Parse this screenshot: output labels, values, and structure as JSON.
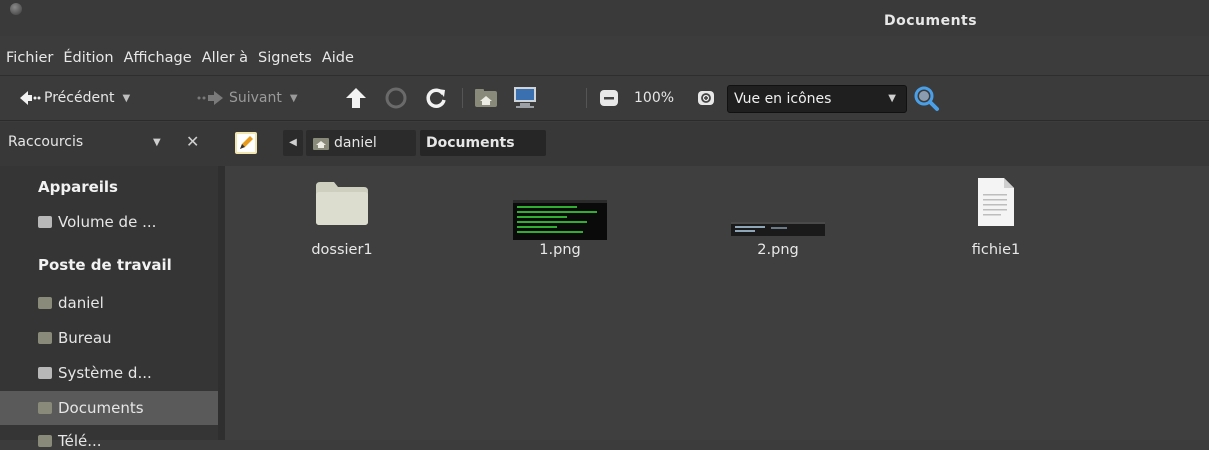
{
  "window": {
    "title": "Documents"
  },
  "menu": [
    "Fichier",
    "Édition",
    "Affichage",
    "Aller à",
    "Signets",
    "Aide"
  ],
  "toolbar": {
    "back": "Précédent",
    "forward": "Suivant",
    "zoom": "100%",
    "view_mode": "Vue en icônes"
  },
  "sidebar_header": {
    "title": "Raccourcis"
  },
  "breadcrumbs": {
    "home": "daniel",
    "current": "Documents"
  },
  "sidebar": {
    "section1": "Appareils",
    "device1": "Volume de ...",
    "section2": "Poste de travail",
    "item_daniel": "daniel",
    "item_bureau": "Bureau",
    "item_system": "Système d...",
    "item_documents": "Documents",
    "item_partial": "Télé..."
  },
  "files": [
    {
      "name": "dossier1",
      "type": "folder"
    },
    {
      "name": "1.png",
      "type": "image"
    },
    {
      "name": "2.png",
      "type": "image"
    },
    {
      "name": "fichie1",
      "type": "text"
    }
  ],
  "colors": {
    "background": "#3f3f3f",
    "accent_search": "#4aa0e8",
    "selection": "#5a5a5a"
  }
}
